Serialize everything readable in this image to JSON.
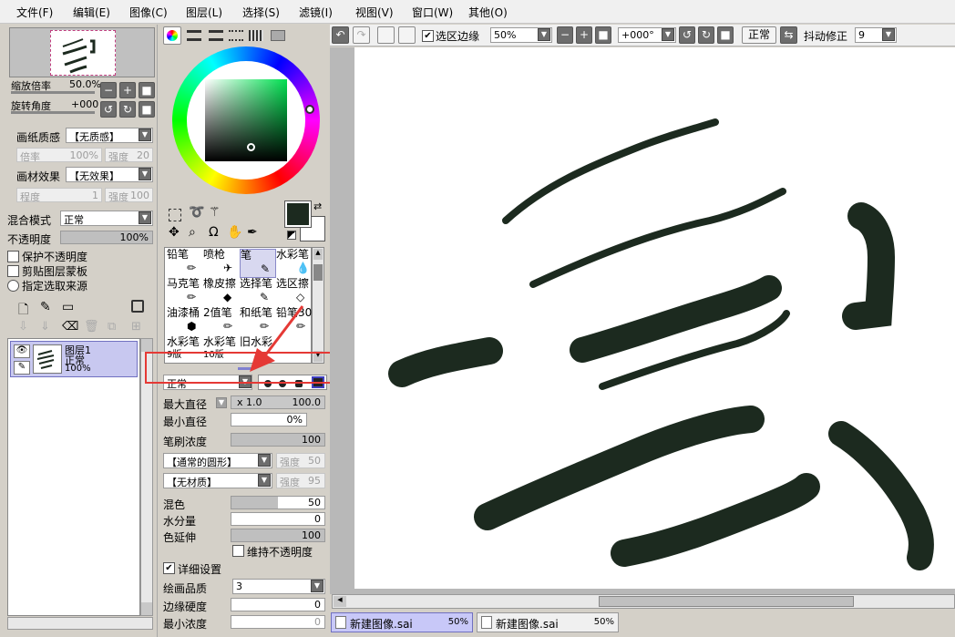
{
  "menu": [
    "文件(F)",
    "编辑(E)",
    "图像(C)",
    "图层(L)",
    "选择(S)",
    "滤镜(I)",
    "视图(V)",
    "窗口(W)",
    "其他(O)"
  ],
  "navigator": {
    "zoom_label": "缩放倍率",
    "zoom_value": "50.0%",
    "rotate_label": "旋转角度",
    "rotate_value": "+000"
  },
  "paper": {
    "texture_label": "画纸质感",
    "texture_value": "【无质感】",
    "scale_label": "倍率",
    "scale_value": "100%",
    "strength_label": "强度",
    "strength_value": "20",
    "effect_label": "画材效果",
    "effect_value": "【无效果】",
    "degree_label": "程度",
    "degree_value": "1",
    "strength2_label": "强度",
    "strength2_value": "100"
  },
  "layer_panel": {
    "blend_label": "混合模式",
    "blend_value": "正常",
    "opacity_label": "不透明度",
    "opacity_value": "100%",
    "opacity_fraction": 1.0,
    "check_protect": "保护不透明度",
    "check_clip": "剪贴图层蒙板",
    "check_source": "指定选取来源",
    "layer": {
      "name": "图层1",
      "mode": "正常",
      "opacity": "100%"
    }
  },
  "tools": [
    {
      "name": "铅笔"
    },
    {
      "name": "喷枪"
    },
    {
      "name": "笔"
    },
    {
      "name": "水彩笔"
    },
    {
      "name": "马克笔"
    },
    {
      "name": "橡皮擦"
    },
    {
      "name": "选择笔"
    },
    {
      "name": "选区擦"
    },
    {
      "name": "油漆桶"
    },
    {
      "name": "2值笔"
    },
    {
      "name": "和纸笔"
    },
    {
      "name": "铅笔30"
    },
    {
      "name": "水彩笔",
      "sub": "9版"
    },
    {
      "name": "水彩笔",
      "sub": "10版"
    },
    {
      "name": "旧水彩"
    }
  ],
  "brush": {
    "mode_value": "正常",
    "max_size_label": "最大直径",
    "max_size_mult": "x 1.0",
    "max_size_value": "100.0",
    "min_size_label": "最小直径",
    "min_size_value": "0%",
    "density_label": "笔刷浓度",
    "density_value": "100",
    "density_fraction": 1.0,
    "shape_value": "【通常的圆形】",
    "shape_strength_label": "强度",
    "shape_strength_value": "50",
    "texture_value": "【无材质】",
    "texture_strength_label": "强度",
    "texture_strength_value": "95",
    "blend_label": "混色",
    "blend_value": "50",
    "blend_fraction": 0.5,
    "water_label": "水分量",
    "water_value": "0",
    "water_fraction": 0,
    "persist_label": "色延伸",
    "persist_value": "100",
    "persist_fraction": 1.0,
    "keep_opacity_label": "维持不透明度",
    "advanced_label": "详细设置",
    "quality_label": "绘画品质",
    "quality_value": "3",
    "edge_label": "边缘硬度",
    "edge_value": "0",
    "min_density_label": "最小浓度",
    "min_density_value": "0"
  },
  "toolbar": {
    "selection_edge_label": "选区边缘",
    "zoom_value": "50%",
    "angle_value": "+000°",
    "mode_value": "正常",
    "stabilizer_label": "抖动修正",
    "stabilizer_value": "9"
  },
  "tabs": [
    {
      "name": "新建图像.sai",
      "zoom": "50%"
    },
    {
      "name": "新建图像.sai",
      "zoom": "50%"
    }
  ],
  "colors": {
    "primary": "#1c2a1f",
    "secondary": "#ffffff",
    "highlight_box": "#e53935",
    "arrow": "#e53935"
  }
}
